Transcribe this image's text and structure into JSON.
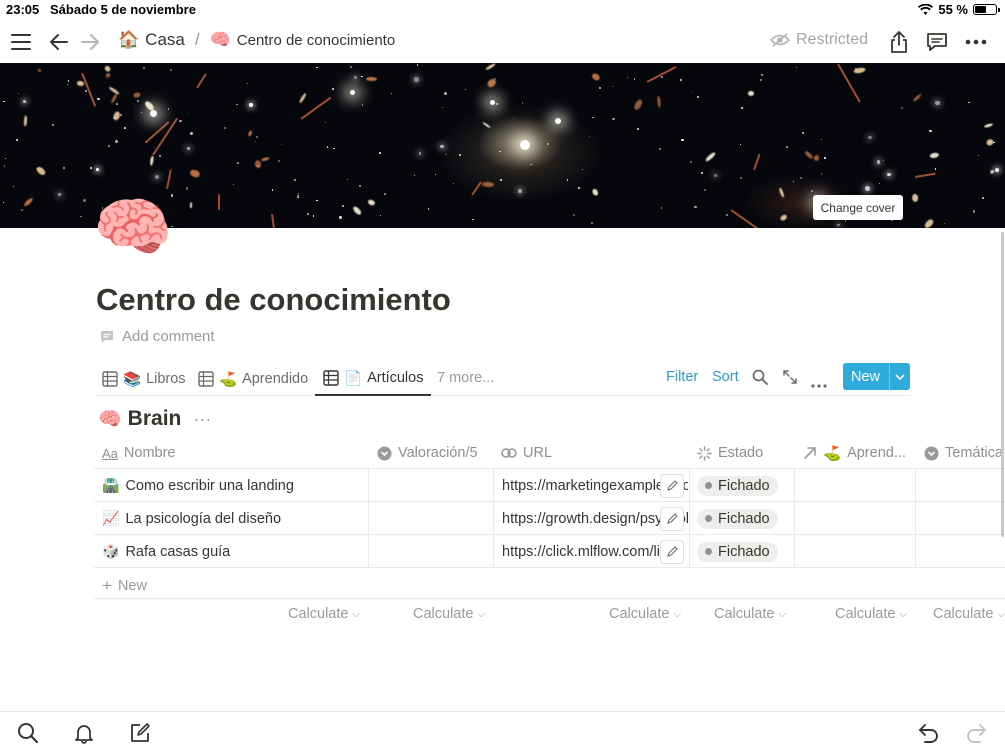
{
  "status_bar": {
    "time": "23:05",
    "date": "Sábado 5 de noviembre",
    "battery": "55 %",
    "battery_level": 0.55
  },
  "topbar": {
    "breadcrumb": [
      {
        "icon": "🏠",
        "label": "Casa"
      },
      {
        "icon": "🧠",
        "label": "Centro de conocimiento"
      }
    ],
    "separator": "/",
    "restricted_label": "Restricted"
  },
  "cover": {
    "change_cover_label": "Change cover"
  },
  "page": {
    "icon": "🧠",
    "title": "Centro de conocimiento",
    "add_comment": "Add comment"
  },
  "views": {
    "tabs": [
      {
        "icon": "📚",
        "label": "Libros"
      },
      {
        "icon": "⛳",
        "label": "Aprendido"
      },
      {
        "icon": "📄",
        "label": "Artículos"
      }
    ],
    "more": "7 more...",
    "filter": "Filter",
    "sort": "Sort",
    "new": "New"
  },
  "database": {
    "icon": "🧠",
    "title": "Brain",
    "columns": [
      {
        "icon": "Aa",
        "label": "Nombre"
      },
      {
        "icon": "rating-icon",
        "label": "Valoración/5"
      },
      {
        "icon": "link-icon",
        "label": "URL"
      },
      {
        "icon": "status-icon",
        "label": "Estado"
      },
      {
        "icon": "⛳",
        "label": "Aprend..."
      },
      {
        "icon": "select-icon",
        "label": "Temática"
      }
    ],
    "rows": [
      {
        "icon": "🛣️",
        "name": "Como escribir una landing",
        "url": "https://marketingexamples.co",
        "estado": "Fichado"
      },
      {
        "icon": "📈",
        "name": "La psicología del diseño",
        "url": "https://growth.design/psychology",
        "estado": "Fichado"
      },
      {
        "icon": "🎲",
        "name": "Rafa casas guía",
        "url": "https://click.mlflow.com/link",
        "estado": "Fichado"
      }
    ],
    "new_row": "New",
    "calculate": "Calculate"
  }
}
